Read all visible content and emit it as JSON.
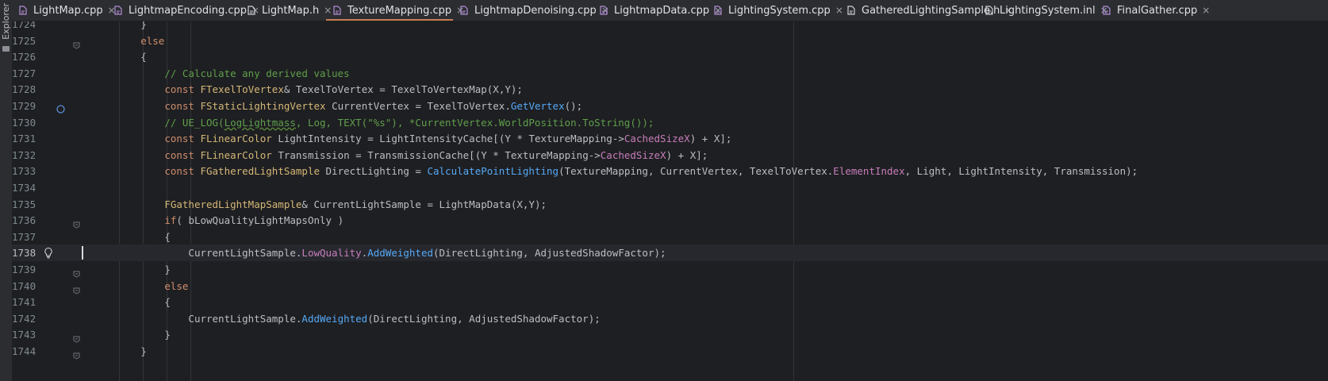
{
  "sidebar": {
    "label": "Explorer"
  },
  "tabs": [
    {
      "label": "LightMap.cpp",
      "kind": "cpp",
      "active": false
    },
    {
      "label": "LightmapEncoding.cpp",
      "kind": "cpp",
      "active": false
    },
    {
      "label": "LightMap.h",
      "kind": "h",
      "active": false
    },
    {
      "label": "TextureMapping.cpp",
      "kind": "cpp",
      "active": true
    },
    {
      "label": "LightmapDenoising.cpp",
      "kind": "cpp",
      "active": false
    },
    {
      "label": "LightmapData.cpp",
      "kind": "cpp",
      "active": false
    },
    {
      "label": "LightingSystem.cpp",
      "kind": "cpp",
      "active": false
    },
    {
      "label": "GatheredLightingSample.h",
      "kind": "h",
      "active": false
    },
    {
      "label": "LightingSystem.inl",
      "kind": "inl",
      "active": false
    },
    {
      "label": "FinalGather.cpp",
      "kind": "cpp",
      "active": false
    }
  ],
  "tab_close_glyph": "×",
  "colors": {
    "background": "#1e1f22",
    "keyword": "#cf8e6d",
    "type": "#d5b778",
    "function": "#56a8f5",
    "member": "#c77dbb",
    "comment": "#5f9f4b",
    "string": "#6aab73",
    "line_number": "#7f8b91",
    "active_tab_underline": "#c77d55"
  },
  "editor": {
    "current_line": 1738,
    "lines": [
      {
        "number": 1724,
        "text": "        }",
        "fold": false
      },
      {
        "number": 1725,
        "text": "        else",
        "fold": true
      },
      {
        "number": 1726,
        "text": "        {",
        "fold": false
      },
      {
        "number": 1727,
        "text": "            // Calculate any derived values",
        "fold": false
      },
      {
        "number": 1728,
        "text": "            const FTexelToVertex& TexelToVertex = TexelToVertexMap(X,Y);",
        "fold": false
      },
      {
        "number": 1729,
        "text": "            const FStaticLightingVertex CurrentVertex = TexelToVertex.GetVertex();",
        "fold": false,
        "marker": "breakpoint-icon"
      },
      {
        "number": 1730,
        "text": "            // UE_LOG(LogLightmass, Log, TEXT(\"%s\"), *CurrentVertex.WorldPosition.ToString());",
        "fold": false
      },
      {
        "number": 1731,
        "text": "            const FLinearColor LightIntensity = LightIntensityCache[(Y * TextureMapping->CachedSizeX) + X];",
        "fold": false
      },
      {
        "number": 1732,
        "text": "            const FLinearColor Transmission = TransmissionCache[(Y * TextureMapping->CachedSizeX) + X];",
        "fold": false
      },
      {
        "number": 1733,
        "text": "            const FGatheredLightSample DirectLighting = CalculatePointLighting(TextureMapping, CurrentVertex, TexelToVertex.ElementIndex, Light, LightIntensity, Transmission);",
        "fold": false
      },
      {
        "number": 1734,
        "text": "",
        "fold": false
      },
      {
        "number": 1735,
        "text": "            FGatheredLightMapSample& CurrentLightSample = LightMapData(X,Y);",
        "fold": false
      },
      {
        "number": 1736,
        "text": "            if( bLowQualityLightMapsOnly )",
        "fold": true
      },
      {
        "number": 1737,
        "text": "            {",
        "fold": false
      },
      {
        "number": 1738,
        "text": "                CurrentLightSample.LowQuality.AddWeighted(DirectLighting, AdjustedShadowFactor);",
        "fold": false,
        "marker": "lightbulb-icon"
      },
      {
        "number": 1739,
        "text": "            }",
        "fold": true
      },
      {
        "number": 1740,
        "text": "            else",
        "fold": true
      },
      {
        "number": 1741,
        "text": "            {",
        "fold": false
      },
      {
        "number": 1742,
        "text": "                CurrentLightSample.AddWeighted(DirectLighting, AdjustedShadowFactor);",
        "fold": false
      },
      {
        "number": 1743,
        "text": "            }",
        "fold": true
      },
      {
        "number": 1744,
        "text": "        }",
        "fold": true
      }
    ]
  }
}
